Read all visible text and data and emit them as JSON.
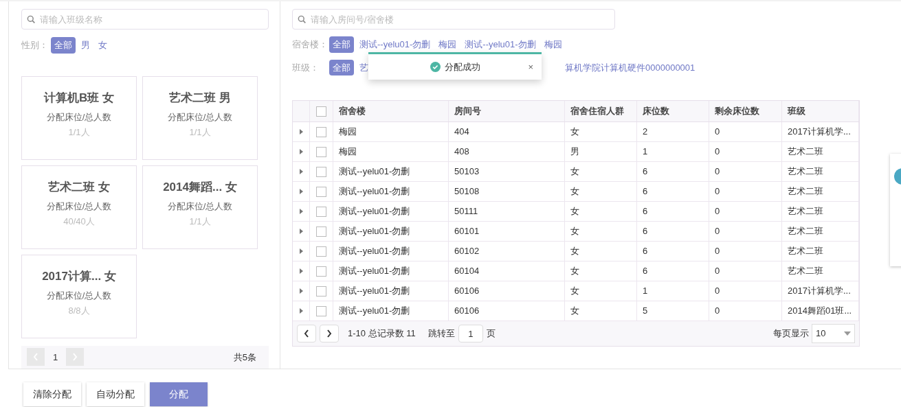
{
  "class_search": {
    "placeholder": "请输入班级名称"
  },
  "gender_filter": {
    "label": "性别：",
    "options": [
      {
        "label": "全部",
        "selected": true
      },
      {
        "label": "男",
        "selected": false
      },
      {
        "label": "女",
        "selected": false
      }
    ]
  },
  "class_cards": [
    {
      "name": "计算机B班 女",
      "caption": "分配床位/总人数",
      "count": "1/1人"
    },
    {
      "name": "艺术二班 男",
      "caption": "分配床位/总人数",
      "count": "1/1人"
    },
    {
      "name": "艺术二班 女",
      "caption": "分配床位/总人数",
      "count": "40/40人"
    },
    {
      "name": "2014舞蹈... 女",
      "caption": "分配床位/总人数",
      "count": "1/1人"
    },
    {
      "name": "2017计算... 女",
      "caption": "分配床位/总人数",
      "count": "8/8人"
    }
  ],
  "card_pager": {
    "page": "1",
    "total": "共5条"
  },
  "room_search": {
    "placeholder": "请输入房间号/宿舍楼"
  },
  "building_filter": {
    "label": "宿舍楼：",
    "options": [
      {
        "label": "全部",
        "selected": true
      },
      {
        "label": "测试--yelu01-勿删",
        "selected": false
      },
      {
        "label": "梅园",
        "selected": false
      },
      {
        "label": "测试--yelu01-勿删",
        "selected": false
      },
      {
        "label": "梅园",
        "selected": false
      }
    ]
  },
  "class_filter": {
    "label": "班级：",
    "options": [
      {
        "label": "全部",
        "selected": true
      },
      {
        "label": "艺",
        "selected": false
      },
      {
        "label": "算机学院计算机硬件0000000001",
        "selected": false
      }
    ]
  },
  "toast": {
    "text": "分配成功",
    "close": "×"
  },
  "table": {
    "all_checked": false,
    "columns": [
      "宿舍楼",
      "房间号",
      "宿舍住宿人群",
      "床位数",
      "剩余床位数",
      "班级"
    ],
    "rows": [
      {
        "checked": false,
        "cells": [
          "梅园",
          "404",
          "女",
          "2",
          "0",
          "2017计算机学..."
        ]
      },
      {
        "checked": false,
        "cells": [
          "梅园",
          "408",
          "男",
          "1",
          "0",
          "艺术二班"
        ]
      },
      {
        "checked": false,
        "cells": [
          "测试--yelu01-勿删",
          "50103",
          "女",
          "6",
          "0",
          "艺术二班"
        ]
      },
      {
        "checked": false,
        "cells": [
          "测试--yelu01-勿删",
          "50108",
          "女",
          "6",
          "0",
          "艺术二班"
        ]
      },
      {
        "checked": false,
        "cells": [
          "测试--yelu01-勿删",
          "50111",
          "女",
          "6",
          "0",
          "艺术二班"
        ]
      },
      {
        "checked": false,
        "cells": [
          "测试--yelu01-勿删",
          "60101",
          "女",
          "6",
          "0",
          "艺术二班"
        ]
      },
      {
        "checked": false,
        "cells": [
          "测试--yelu01-勿删",
          "60102",
          "女",
          "6",
          "0",
          "艺术二班"
        ]
      },
      {
        "checked": false,
        "cells": [
          "测试--yelu01-勿删",
          "60104",
          "女",
          "6",
          "0",
          "艺术二班"
        ]
      },
      {
        "checked": false,
        "cells": [
          "测试--yelu01-勿删",
          "60106",
          "女",
          "1",
          "0",
          "2017计算机学..."
        ]
      },
      {
        "checked": false,
        "cells": [
          "测试--yelu01-勿删",
          "60106",
          "女",
          "5",
          "0",
          "2014舞蹈01班..."
        ]
      }
    ]
  },
  "table_pager": {
    "summary": "1-10 总记录数 11",
    "jump_label": "跳转至",
    "jump_value": "1",
    "page_unit": "页",
    "size_label": "每页显示",
    "size_value": "10"
  },
  "actions": [
    {
      "label": "清除分配",
      "primary": false
    },
    {
      "label": "自动分配",
      "primary": false
    },
    {
      "label": "分配",
      "primary": true
    }
  ]
}
